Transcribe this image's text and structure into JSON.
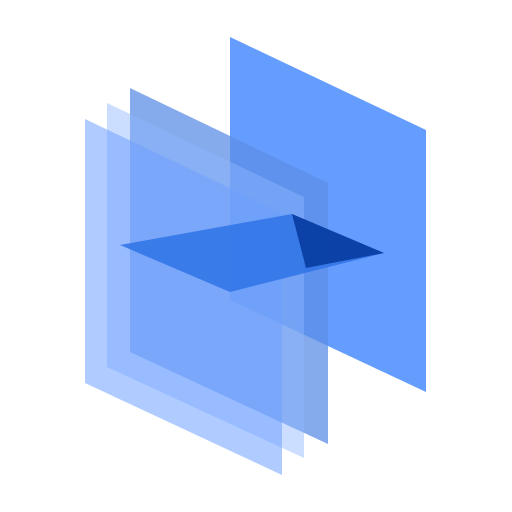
{
  "logo": {
    "name": "stacked-planes-logo",
    "colors": {
      "back_plane": "#4a8cff",
      "mid_plane_dark": "#5d8fe6",
      "mid_plane_light": "#8fb6ff",
      "front_plane": "#6ea1ff",
      "horizontal_plane": "#2f73e6",
      "overlap_dark": "#0a3fa3"
    }
  }
}
